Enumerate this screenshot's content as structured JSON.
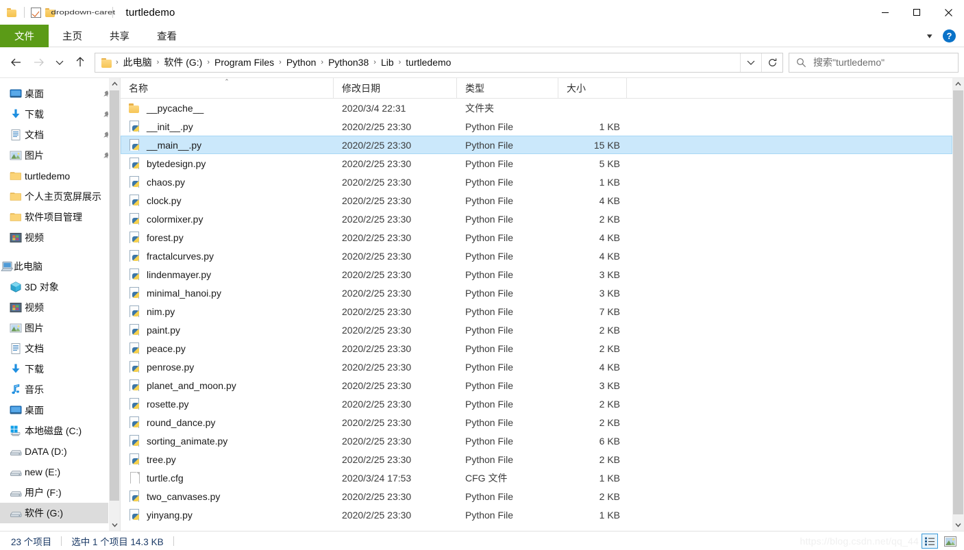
{
  "window": {
    "title": "turtledemo",
    "qat": [
      "folder-icon",
      "checkbox-icon",
      "folder-icon",
      "dropdown-caret"
    ],
    "minimize": "—",
    "maximize": "☐",
    "close": "✕"
  },
  "ribbon": {
    "tabs": [
      {
        "label": "文件",
        "name": "tab-file",
        "active": true
      },
      {
        "label": "主页",
        "name": "tab-home",
        "active": false
      },
      {
        "label": "共享",
        "name": "tab-share",
        "active": false
      },
      {
        "label": "查看",
        "name": "tab-view",
        "active": false
      }
    ],
    "accent": "#5b9b17",
    "help_label": "?",
    "expand_caret": "⌄"
  },
  "nav": {
    "back": "←",
    "forward": "→",
    "recent": "⌄",
    "up": "↑",
    "breadcrumbs": [
      "此电脑",
      "软件 (G:)",
      "Program Files",
      "Python",
      "Python38",
      "Lib",
      "turtledemo"
    ],
    "separator": "›",
    "dropdown": "⌄",
    "refresh": "↻"
  },
  "search": {
    "placeholder": "搜索\"turtledemo\"",
    "icon": "search-icon"
  },
  "sidebar": {
    "quick_access": [
      {
        "label": "桌面",
        "icon": "desktop-icon",
        "pinned": true
      },
      {
        "label": "下载",
        "icon": "download-icon",
        "pinned": true
      },
      {
        "label": "文档",
        "icon": "documents-icon",
        "pinned": true
      },
      {
        "label": "图片",
        "icon": "pictures-icon",
        "pinned": true
      },
      {
        "label": "turtledemo",
        "icon": "folder-icon",
        "pinned": false
      },
      {
        "label": "个人主页宽屏展示",
        "icon": "folder-icon",
        "pinned": false
      },
      {
        "label": "软件项目管理",
        "icon": "folder-icon",
        "pinned": false
      },
      {
        "label": "视频",
        "icon": "videos-icon",
        "pinned": false
      }
    ],
    "this_pc": {
      "label": "此电脑",
      "icon": "this-pc-icon"
    },
    "this_pc_children": [
      {
        "label": "3D 对象",
        "icon": "3d-objects-icon",
        "selected": false
      },
      {
        "label": "视频",
        "icon": "videos-icon",
        "selected": false
      },
      {
        "label": "图片",
        "icon": "pictures-icon",
        "selected": false
      },
      {
        "label": "文档",
        "icon": "documents-icon",
        "selected": false
      },
      {
        "label": "下载",
        "icon": "download-icon",
        "selected": false
      },
      {
        "label": "音乐",
        "icon": "music-icon",
        "selected": false
      },
      {
        "label": "桌面",
        "icon": "desktop-icon",
        "selected": false
      },
      {
        "label": "本地磁盘 (C:)",
        "icon": "windows-drive-icon",
        "selected": false
      },
      {
        "label": "DATA (D:)",
        "icon": "drive-icon",
        "selected": false
      },
      {
        "label": "new (E:)",
        "icon": "drive-icon",
        "selected": false
      },
      {
        "label": "用户 (F:)",
        "icon": "drive-icon",
        "selected": false
      },
      {
        "label": "软件 (G:)",
        "icon": "drive-icon",
        "selected": true
      }
    ]
  },
  "list": {
    "columns": [
      {
        "label": "名称",
        "name": "column-name",
        "sorted": true
      },
      {
        "label": "修改日期",
        "name": "column-date-modified",
        "sorted": false
      },
      {
        "label": "类型",
        "name": "column-type",
        "sorted": false
      },
      {
        "label": "大小",
        "name": "column-size",
        "sorted": false
      }
    ],
    "sort_indicator": "⌃",
    "selection_color": "#cbe8fb",
    "rows": [
      {
        "name": "__pycache__",
        "date": "2020/3/4 22:31",
        "type": "文件夹",
        "size": "",
        "icon": "folder-icon",
        "selected": false
      },
      {
        "name": "__init__.py",
        "date": "2020/2/25 23:30",
        "type": "Python File",
        "size": "1 KB",
        "icon": "python-file-icon",
        "selected": false
      },
      {
        "name": "__main__.py",
        "date": "2020/2/25 23:30",
        "type": "Python File",
        "size": "15 KB",
        "icon": "python-file-icon",
        "selected": true
      },
      {
        "name": "bytedesign.py",
        "date": "2020/2/25 23:30",
        "type": "Python File",
        "size": "5 KB",
        "icon": "python-file-icon",
        "selected": false
      },
      {
        "name": "chaos.py",
        "date": "2020/2/25 23:30",
        "type": "Python File",
        "size": "1 KB",
        "icon": "python-file-icon",
        "selected": false
      },
      {
        "name": "clock.py",
        "date": "2020/2/25 23:30",
        "type": "Python File",
        "size": "4 KB",
        "icon": "python-file-icon",
        "selected": false
      },
      {
        "name": "colormixer.py",
        "date": "2020/2/25 23:30",
        "type": "Python File",
        "size": "2 KB",
        "icon": "python-file-icon",
        "selected": false
      },
      {
        "name": "forest.py",
        "date": "2020/2/25 23:30",
        "type": "Python File",
        "size": "4 KB",
        "icon": "python-file-icon",
        "selected": false
      },
      {
        "name": "fractalcurves.py",
        "date": "2020/2/25 23:30",
        "type": "Python File",
        "size": "4 KB",
        "icon": "python-file-icon",
        "selected": false
      },
      {
        "name": "lindenmayer.py",
        "date": "2020/2/25 23:30",
        "type": "Python File",
        "size": "3 KB",
        "icon": "python-file-icon",
        "selected": false
      },
      {
        "name": "minimal_hanoi.py",
        "date": "2020/2/25 23:30",
        "type": "Python File",
        "size": "3 KB",
        "icon": "python-file-icon",
        "selected": false
      },
      {
        "name": "nim.py",
        "date": "2020/2/25 23:30",
        "type": "Python File",
        "size": "7 KB",
        "icon": "python-file-icon",
        "selected": false
      },
      {
        "name": "paint.py",
        "date": "2020/2/25 23:30",
        "type": "Python File",
        "size": "2 KB",
        "icon": "python-file-icon",
        "selected": false
      },
      {
        "name": "peace.py",
        "date": "2020/2/25 23:30",
        "type": "Python File",
        "size": "2 KB",
        "icon": "python-file-icon",
        "selected": false
      },
      {
        "name": "penrose.py",
        "date": "2020/2/25 23:30",
        "type": "Python File",
        "size": "4 KB",
        "icon": "python-file-icon",
        "selected": false
      },
      {
        "name": "planet_and_moon.py",
        "date": "2020/2/25 23:30",
        "type": "Python File",
        "size": "3 KB",
        "icon": "python-file-icon",
        "selected": false
      },
      {
        "name": "rosette.py",
        "date": "2020/2/25 23:30",
        "type": "Python File",
        "size": "2 KB",
        "icon": "python-file-icon",
        "selected": false
      },
      {
        "name": "round_dance.py",
        "date": "2020/2/25 23:30",
        "type": "Python File",
        "size": "2 KB",
        "icon": "python-file-icon",
        "selected": false
      },
      {
        "name": "sorting_animate.py",
        "date": "2020/2/25 23:30",
        "type": "Python File",
        "size": "6 KB",
        "icon": "python-file-icon",
        "selected": false
      },
      {
        "name": "tree.py",
        "date": "2020/2/25 23:30",
        "type": "Python File",
        "size": "2 KB",
        "icon": "python-file-icon",
        "selected": false
      },
      {
        "name": "turtle.cfg",
        "date": "2020/3/24 17:53",
        "type": "CFG 文件",
        "size": "1 KB",
        "icon": "cfg-file-icon",
        "selected": false
      },
      {
        "name": "two_canvases.py",
        "date": "2020/2/25 23:30",
        "type": "Python File",
        "size": "2 KB",
        "icon": "python-file-icon",
        "selected": false
      },
      {
        "name": "yinyang.py",
        "date": "2020/2/25 23:30",
        "type": "Python File",
        "size": "1 KB",
        "icon": "python-file-icon",
        "selected": false
      }
    ]
  },
  "status": {
    "item_count": "23 个项目",
    "selection": "选中 1 个项目  14.3 KB",
    "watermark": "https://blog.csdn.net/qq_44",
    "view_details": "details-view-icon",
    "view_thumbnails": "thumbnail-view-icon"
  }
}
